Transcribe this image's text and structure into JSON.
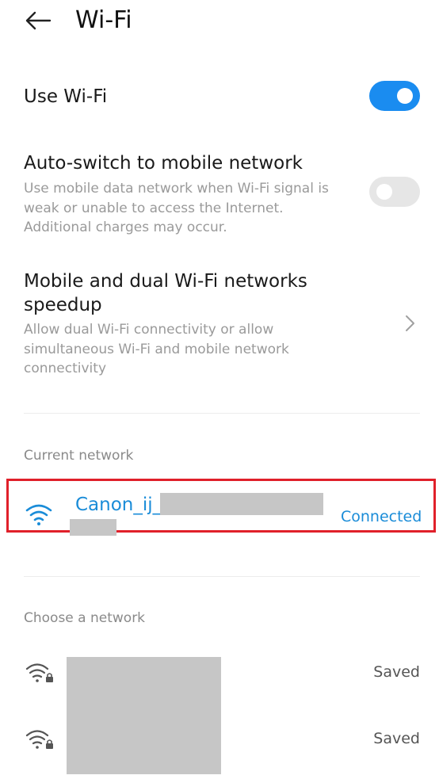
{
  "header": {
    "title": "Wi-Fi",
    "back_icon": "arrow-left-icon"
  },
  "use_wifi": {
    "title": "Use Wi-Fi",
    "enabled": true,
    "accent": "#1a8cf0"
  },
  "auto_switch": {
    "title": "Auto-switch to mobile network",
    "subtitle": "Use mobile data network when Wi-Fi signal is weak or unable to access the Internet. Additional charges may occur.",
    "enabled": false
  },
  "dual_speedup": {
    "title": "Mobile and dual Wi-Fi networks speedup",
    "subtitle": "Allow dual Wi-Fi connectivity or allow simultaneous Wi-Fi and mobile network connectivity",
    "icon": "chevron-right-icon"
  },
  "current_network": {
    "section_label": "Current network",
    "name": "Canon_ij_",
    "status": "Connected",
    "icon": "wifi-icon",
    "highlight_color": "#e0202a"
  },
  "choose_network": {
    "section_label": "Choose a network",
    "networks": [
      {
        "status": "Saved",
        "icon": "wifi-locked-icon"
      },
      {
        "status": "Saved",
        "icon": "wifi-locked-icon"
      }
    ]
  }
}
